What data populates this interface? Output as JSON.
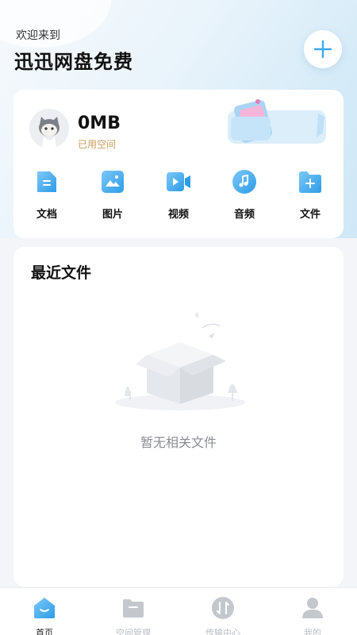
{
  "header": {
    "welcome": "欢迎来到",
    "brand": "迅迅网盘免费"
  },
  "storage": {
    "used": "0MB",
    "label": "已用空间"
  },
  "categories": [
    {
      "label": "文档",
      "icon": "document-icon"
    },
    {
      "label": "图片",
      "icon": "image-icon"
    },
    {
      "label": "视频",
      "icon": "video-icon"
    },
    {
      "label": "音频",
      "icon": "audio-icon"
    },
    {
      "label": "文件",
      "icon": "folder-add-icon"
    }
  ],
  "recent": {
    "title": "最近文件",
    "empty_text": "暂无相关文件"
  },
  "tabs": [
    {
      "label": "首页",
      "icon": "home-icon",
      "active": true
    },
    {
      "label": "空间管理",
      "icon": "folder-icon",
      "active": false
    },
    {
      "label": "传输中心",
      "icon": "transfer-icon",
      "active": false
    },
    {
      "label": "我的",
      "icon": "profile-icon",
      "active": false
    }
  ],
  "colors": {
    "accent": "#3aa8ee",
    "storage_label": "#c99b5e",
    "tab_inactive": "#b8bcc2"
  }
}
